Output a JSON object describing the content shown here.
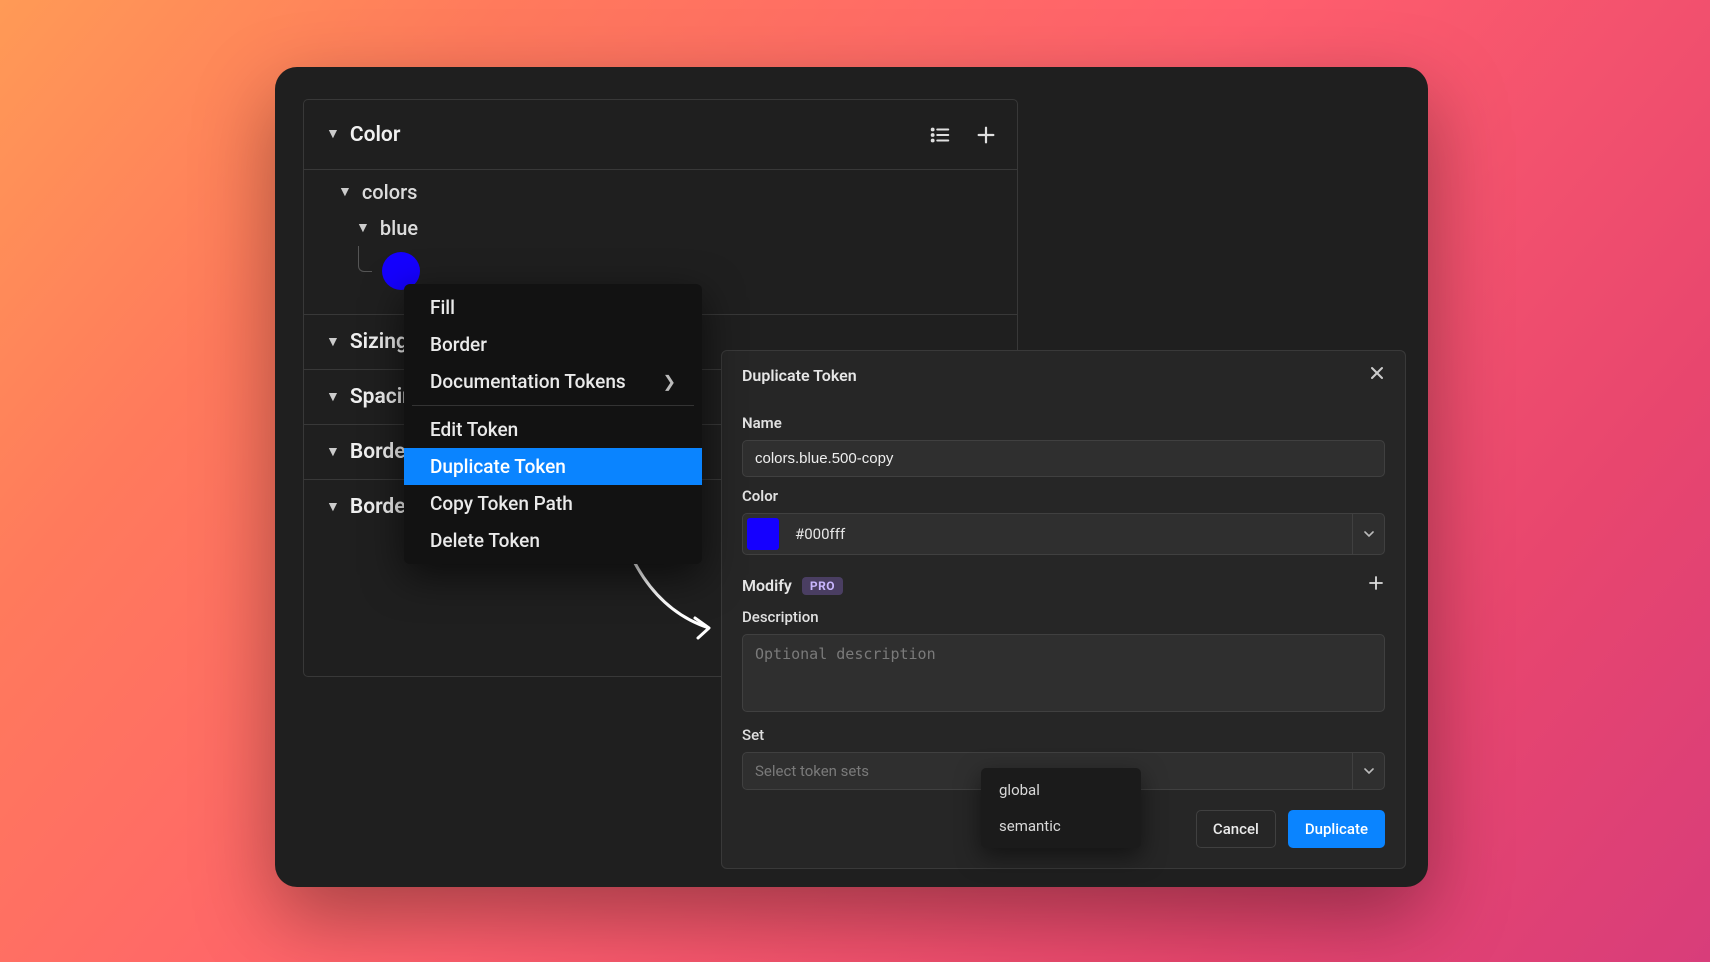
{
  "panel": {
    "header": "Color",
    "tree": {
      "group": "colors",
      "sub": "blue",
      "swatch_color": "#1500ff"
    },
    "sections": [
      "Sizing",
      "Spacing",
      "Border",
      "Border Width"
    ]
  },
  "context_menu": {
    "items_a": [
      "Fill",
      "Border"
    ],
    "submenu_item": "Documentation Tokens",
    "items_b": [
      "Edit Token",
      "Duplicate Token",
      "Copy Token Path",
      "Delete Token"
    ],
    "selected": "Duplicate Token"
  },
  "modal": {
    "title": "Duplicate Token",
    "name_label": "Name",
    "name_value": "colors.blue.500-copy",
    "color_label": "Color",
    "color_value": "#000fff",
    "modify_label": "Modify",
    "pro": "PRO",
    "desc_label": "Description",
    "desc_placeholder": "Optional description",
    "set_label": "Set",
    "set_placeholder": "Select token sets",
    "cancel": "Cancel",
    "confirm": "Duplicate",
    "set_options": [
      "global",
      "semantic"
    ]
  }
}
